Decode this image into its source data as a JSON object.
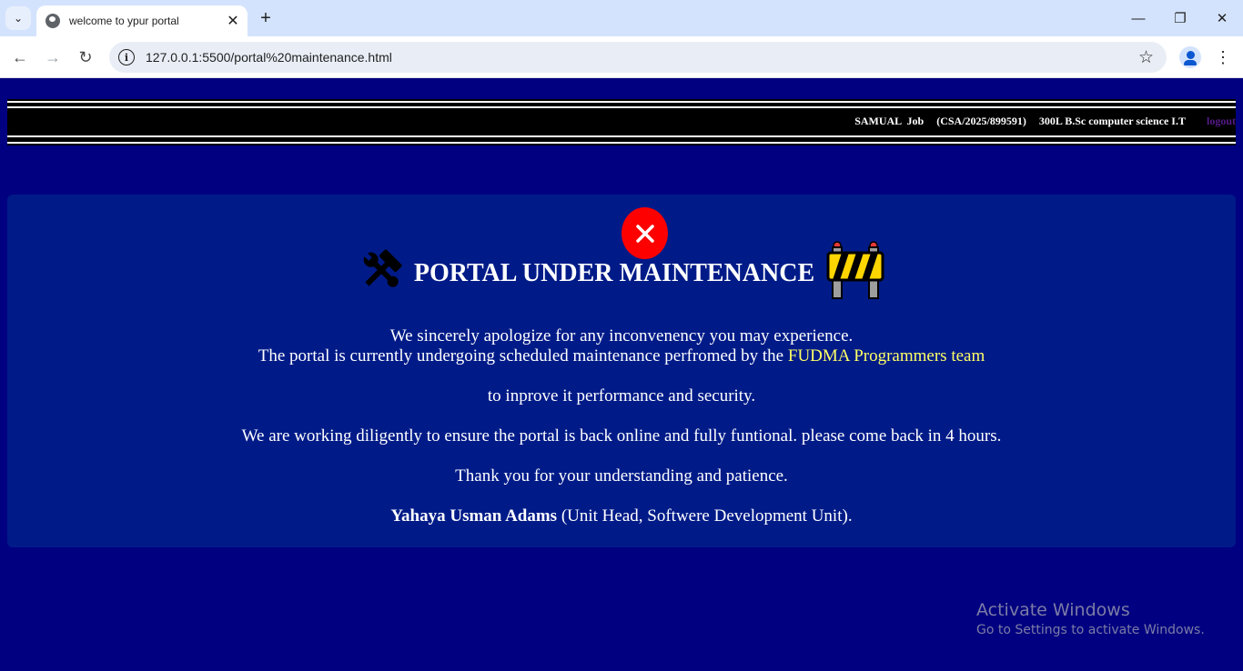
{
  "browser": {
    "tab_title": "welcome to ypur portal",
    "tab_close": "✕",
    "new_tab": "+",
    "url": "127.0.0.1:5500/portal%20maintenance.html",
    "nav_back": "←",
    "nav_forward": "→",
    "nav_reload": "↻",
    "window_minimize": "—",
    "window_restore": "❐",
    "window_close": "✕",
    "bookmark_star": "☆",
    "menu": "⋮",
    "tab_search": "⌄"
  },
  "header": {
    "name": "SAMUAL  Job",
    "reg_no": "(CSA/2025/899591)",
    "program": "300L B.Sc computer science I.T",
    "logout": "logout"
  },
  "notice": {
    "heading": "PORTAL UNDER MAINTENANCE",
    "line1": "We sincerely apologize for any inconvenency you may experience.",
    "line2_prefix": "The portal is currently undergoing scheduled maintenance perfromed by the ",
    "team": "FUDMA Programmers team",
    "line3": "to inprove it performance and security.",
    "line4": "We are working diligently to ensure the portal is back online and fully funtional. please come back in 4 hours.",
    "line5": "Thank you for your understanding and patience.",
    "signatory": "Yahaya Usman Adams",
    "signatory_role": " (Unit Head, Softwere Development Unit)."
  },
  "watermark": {
    "title": "Activate Windows",
    "subtitle": "Go to Settings to activate Windows."
  },
  "colors": {
    "page_bg": "#000080",
    "card_bg": "#001b88",
    "highlight": "#ffff66",
    "error_red": "#ff0000"
  }
}
